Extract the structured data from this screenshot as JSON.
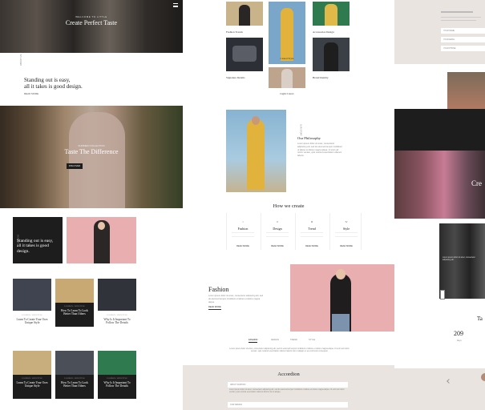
{
  "left": {
    "hero": {
      "title": "Create Perfect Taste",
      "eyebrow": "WELCOME TO LITTLE"
    },
    "intro": {
      "side_label": "ABOUT US",
      "text1": "Standing out is easy,",
      "text2": "all it takes is good design.",
      "link": "READ MORE"
    },
    "banner": {
      "title": "Taste The Difference",
      "eyebrow": "SUMMER COLLECTION",
      "button": "DISCOVER"
    },
    "dark_block": {
      "text": "Standing out is easy, all it takes is good design.",
      "side_label": "FASHION"
    },
    "posts_row1": [
      {
        "title": "Learn To Create Your Own Unique Style",
        "meta": "FASHION / LIFESTYLE"
      },
      {
        "title": "How To Learn To Look Better Than Others",
        "meta": "FASHION / LIFESTYLE",
        "highlight": true
      },
      {
        "title": "Why Is It Important To Follow The Details",
        "meta": "FASHION / LIFESTYLE"
      }
    ],
    "posts_row2": [
      {
        "title": "Learn To Create Your Own Unique Style",
        "meta": "FASHION / LIFESTYLE"
      },
      {
        "title": "How To Learn To Look Better Than Others",
        "meta": "FASHION / LIFESTYLE"
      },
      {
        "title": "Why Is It Important To Follow The Details",
        "meta": "FASHION / LIFESTYLE"
      }
    ]
  },
  "middle": {
    "categories": [
      {
        "label": "Fashion Trends"
      },
      {
        "label": "Casual Style"
      },
      {
        "label": "Accessories Design"
      },
      {
        "label": "Signature Details"
      },
      {
        "label": "Light Colors"
      },
      {
        "label": "Brand Identity"
      }
    ],
    "philosophy": {
      "side_label": "OUR STORY",
      "title": "Our Philosophy",
      "body": "Lorem ipsum dolor sit amet, consectetur adipiscing elit, sed do eiusmod tempor incididunt ut labore et dolore magna aliqua. Ut enim ad minim veniam, quis nostrud exercitation ullamco laboris."
    },
    "how_we_create": {
      "title": "How we create",
      "steps": [
        {
          "num": "I",
          "title": "Fashion",
          "link": "READ MORE"
        },
        {
          "num": "II",
          "title": "Design",
          "link": "READ MORE"
        },
        {
          "num": "III",
          "title": "Trend",
          "link": "READ MORE"
        },
        {
          "num": "IV",
          "title": "Style",
          "link": "READ MORE"
        }
      ]
    },
    "fashion": {
      "title": "Fashion",
      "body": "Lorem ipsum dolor sit amet, consectetur adipiscing elit, sed do eiusmod tempor incididunt ut labore et dolore magna aliqua.",
      "link": "READ MORE"
    },
    "tabs": [
      "FASHION",
      "DESIGN",
      "TREND",
      "STYLE"
    ],
    "tab_body": "Lorem ipsum dolor sit amet, consectetur adipiscing elit, sed do eiusmod tempor incididunt ut labore et dolore magna aliqua. Ut enim ad minim veniam, quis nostrud exercitation ullamco laboris nisi ut aliquip ex ea commodo consequat.",
    "accordion": {
      "title": "Accordion",
      "items": [
        "ABOUT FASHION",
        "OUR DESIGN"
      ],
      "body": "Lorem ipsum dolor sit amet, consectetur adipiscing elit, sed do eiusmod tempor incididunt ut labore et dolore magna aliqua. Ut enim ad minim veniam, quis nostrud exercitation ullamco laboris nisi ut aliquip."
    }
  },
  "right": {
    "form_fields": [
      "YOUR NAME",
      "YOUR EMAIL",
      "YOUR PHONE"
    ],
    "stat_number": "209",
    "stat_label": "Days",
    "partial_title": "Cre",
    "caption": "Lorem ipsum dolor sit amet, consectetur adipiscing elit.",
    "partial_heading": "Ta"
  },
  "colors": {
    "dark": "#1d1d1d",
    "beige": "#e9e4df",
    "pink": "#e9aeb0",
    "yellow": "#e2b33c"
  }
}
